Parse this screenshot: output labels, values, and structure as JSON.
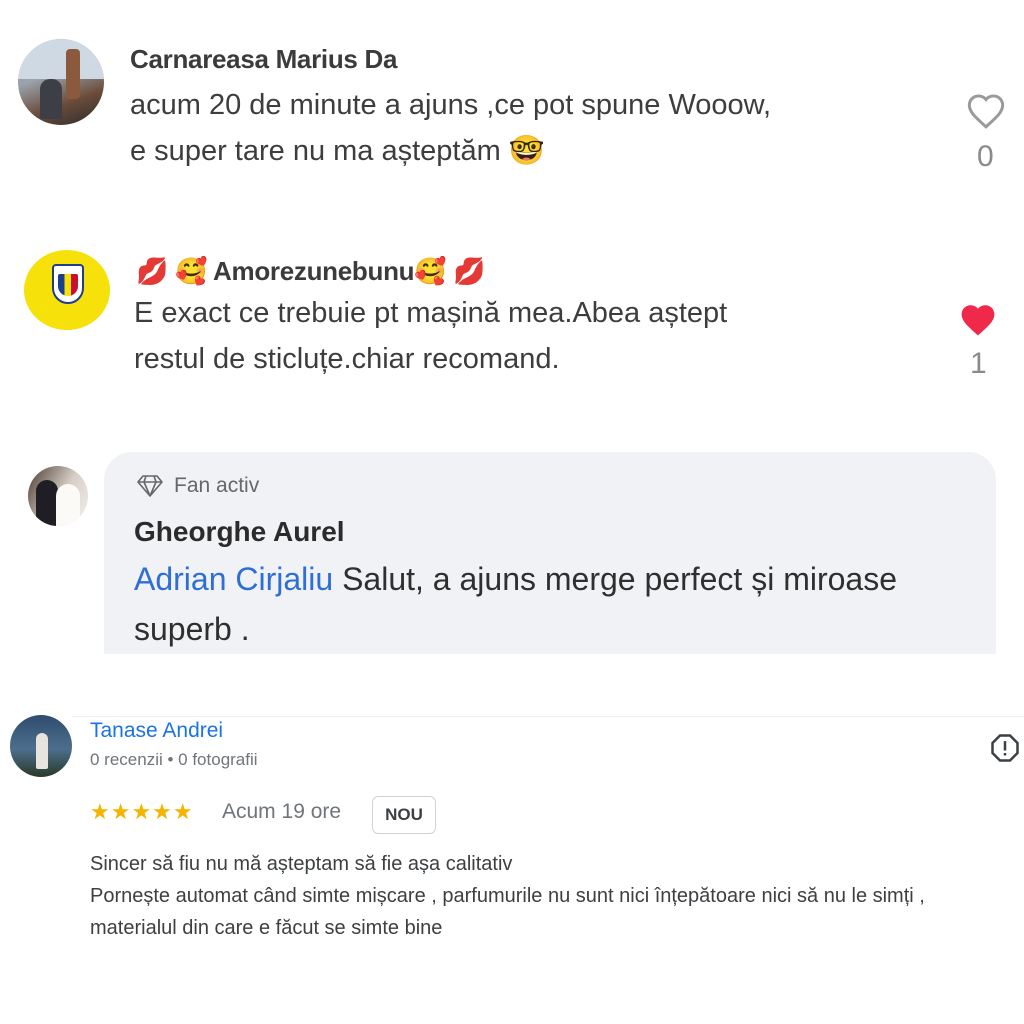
{
  "comments": [
    {
      "author": "Carnareasa Marius Da",
      "text_line1": "acum 20 de minute a ajuns ,ce pot spune Wooow,",
      "text_line2": "e super tare nu ma așteptăm 🤓",
      "likes": "0",
      "liked": false
    },
    {
      "author": "💋 🥰 Amorezunebunu🥰 💋",
      "text_line1": "E exact ce trebuie pt mașină mea.Abea aștept",
      "text_line2": "restul de sticluțe.chiar recomand.",
      "likes": "1",
      "liked": true
    }
  ],
  "reply": {
    "badge": "Fan activ",
    "author": "Gheorghe Aurel",
    "mention": "Adrian Cirjaliu",
    "text": " Salut, a ajuns merge perfect și miroase superb ."
  },
  "review": {
    "author": "Tanase Andrei",
    "meta": "0 recenzii • 0 fotografii",
    "stars": "★★★★★",
    "rating": 5,
    "time": "Acum 19 ore",
    "tag": "NOU",
    "line1": "Sincer să fiu nu mă așteptam să fie așa calitativ",
    "line2": "Pornește automat când simte mișcare , parfumurile nu sunt nici înțepătoare nici să nu le simți , materialul din care e făcut se simte bine"
  },
  "colors": {
    "liked_heart": "#f02849",
    "mention": "#2d6fd6",
    "google_link": "#1a73e8",
    "stars": "#f4b400"
  }
}
